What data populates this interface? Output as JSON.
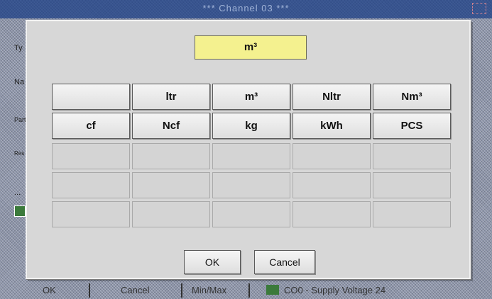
{
  "window": {
    "title": "*** Channel 03 ***"
  },
  "background": {
    "side_labels": [
      "Ty",
      "Na",
      "Part",
      "Res",
      "..."
    ],
    "bottom_bar": [
      "OK",
      "Cancel",
      "Min/Max",
      "CO0 - Supply Voltage 24"
    ]
  },
  "dialog": {
    "current_value": "m³",
    "units": [
      [
        "",
        "ltr",
        "m³",
        "Nltr",
        "Nm³"
      ],
      [
        "cf",
        "Ncf",
        "kg",
        "kWh",
        "PCS"
      ],
      [
        "",
        "",
        "",
        "",
        ""
      ],
      [
        "",
        "",
        "",
        "",
        ""
      ],
      [
        "",
        "",
        "",
        "",
        ""
      ]
    ],
    "ok_label": "OK",
    "cancel_label": "Cancel"
  }
}
